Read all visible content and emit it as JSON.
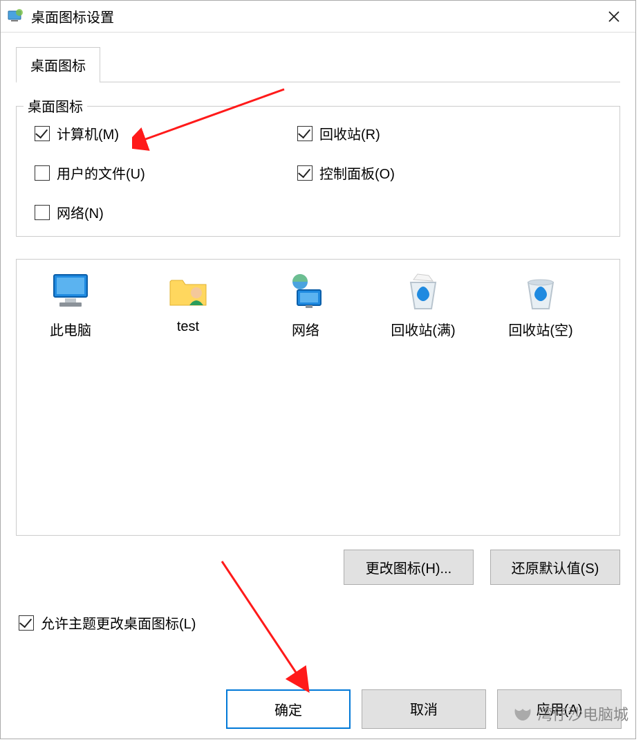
{
  "window": {
    "title": "桌面图标设置"
  },
  "tab": {
    "label": "桌面图标"
  },
  "group": {
    "legend": "桌面图标",
    "items": [
      {
        "label": "计算机(M)",
        "checked": true
      },
      {
        "label": "回收站(R)",
        "checked": true
      },
      {
        "label": "用户的文件(U)",
        "checked": false
      },
      {
        "label": "控制面板(O)",
        "checked": true
      },
      {
        "label": "网络(N)",
        "checked": false
      }
    ]
  },
  "icons": [
    {
      "label": "此电脑"
    },
    {
      "label": "test"
    },
    {
      "label": "网络"
    },
    {
      "label": "回收站(满)"
    },
    {
      "label": "回收站(空)"
    }
  ],
  "buttons": {
    "change": "更改图标(H)...",
    "restore": "还原默认值(S)"
  },
  "allow": {
    "label": "允许主题更改桌面图标(L)",
    "checked": true
  },
  "footer": {
    "ok": "确定",
    "cancel": "取消",
    "apply": "应用(A)"
  },
  "watermark": "湾仔沙电脑城"
}
